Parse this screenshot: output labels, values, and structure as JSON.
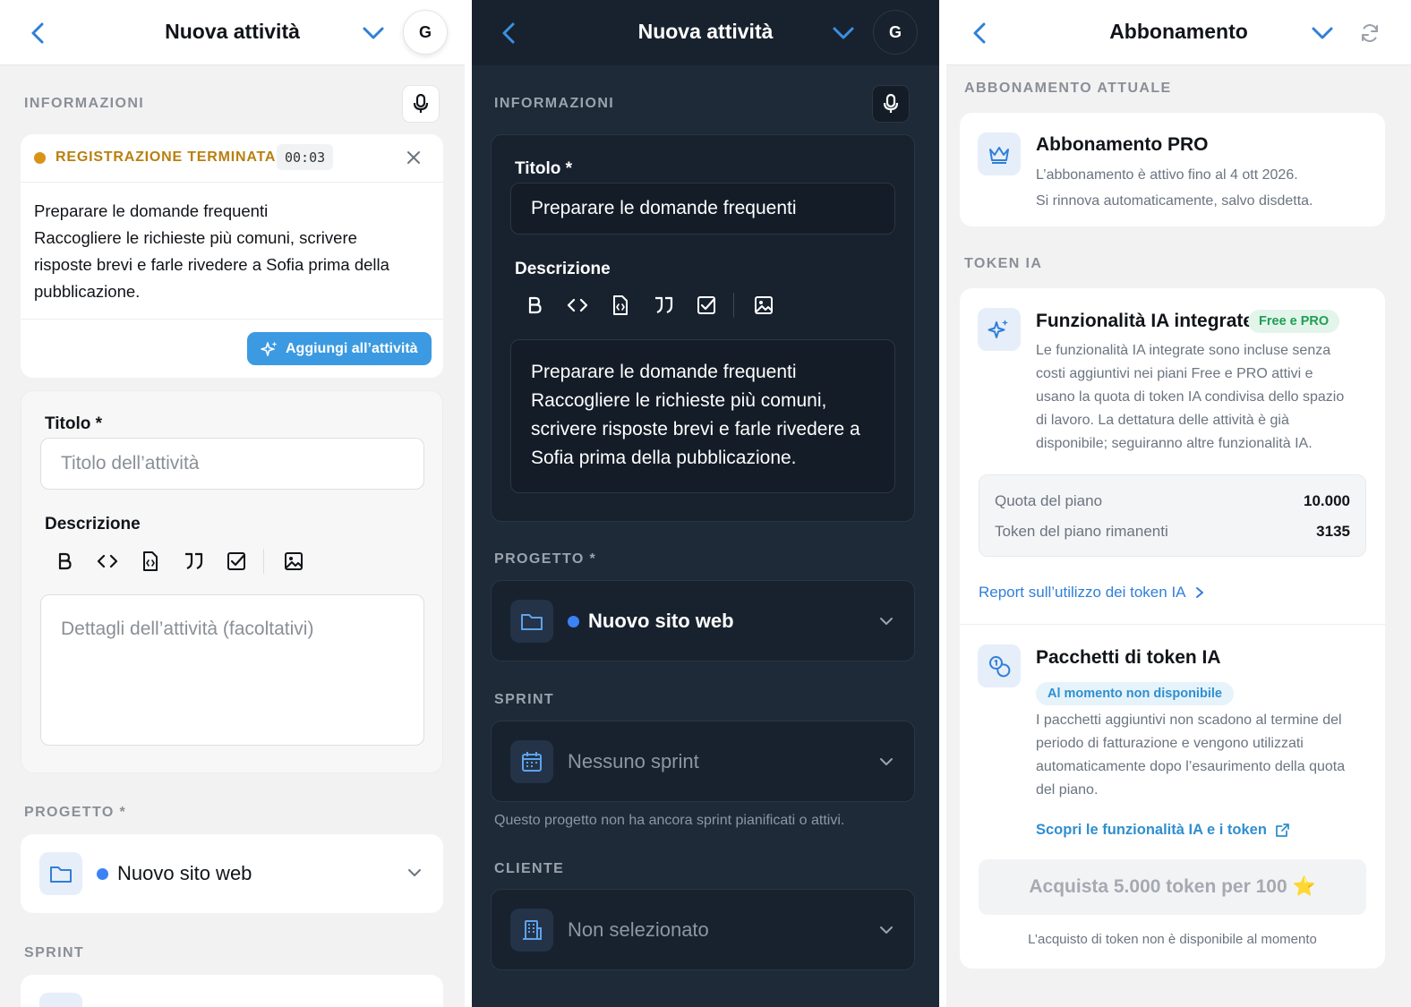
{
  "panel1": {
    "header": {
      "title": "Nuova attività",
      "avatar": "G"
    },
    "section_info": "INFORMAZIONI",
    "recording": {
      "status": "REGISTRAZIONE TERMINATA",
      "timer": "00:03",
      "transcript_lines": [
        "Preparare le domande frequenti",
        "Raccogliere le richieste più comuni, scrivere",
        "risposte brevi e farle rivedere a Sofia prima della",
        "pubblicazione."
      ],
      "add_button": "Aggiungi all’attività"
    },
    "form": {
      "title_label": "Titolo *",
      "title_placeholder": "Titolo dell’attività",
      "description_label": "Descrizione",
      "description_placeholder": "Dettagli dell’attività (facoltativi)"
    },
    "section_project": "PROGETTO *",
    "project_value": "Nuovo sito web",
    "section_sprint": "SPRINT"
  },
  "panel2": {
    "header": {
      "title": "Nuova attività",
      "avatar": "G"
    },
    "section_info": "INFORMAZIONI",
    "title_label": "Titolo *",
    "title_value": "Preparare le domande frequenti",
    "description_label": "Descrizione",
    "description_lines": [
      "Preparare le domande frequenti",
      "Raccogliere le richieste più comuni,",
      "scrivere risposte brevi e farle rivedere a",
      "Sofia prima della pubblicazione."
    ],
    "section_project": "PROGETTO *",
    "project_value": "Nuovo sito web",
    "section_sprint": "SPRINT",
    "sprint_value": "Nessuno sprint",
    "sprint_note": "Questo progetto non ha ancora sprint pianificati o attivi.",
    "section_client": "CLIENTE",
    "client_value": "Non selezionato"
  },
  "panel3": {
    "header": {
      "title": "Abbonamento"
    },
    "section_current": "ABBONAMENTO ATTUALE",
    "plan": {
      "name": "Abbonamento PRO",
      "line1": "L’abbonamento è attivo fino al 4 ott 2026.",
      "line2": "Si rinnova automaticamente, salvo disdetta."
    },
    "section_tokens": "TOKEN IA",
    "ai_features": {
      "title": "Funzionalità IA integrate",
      "badge": "Free e PRO",
      "desc_lines": [
        "Le funzionalità IA integrate sono incluse senza",
        "costi aggiuntivi nei piani Free e PRO attivi e",
        "usano la quota di token IA condivisa dello spazio",
        "di lavoro. La dettatura delle attività è già",
        "disponibile; seguiranno altre funzionalità IA."
      ],
      "quota_label": "Quota del piano",
      "quota_value": "10.000",
      "remaining_label": "Token del piano rimanenti",
      "remaining_value": "3135",
      "report_link": "Report sull’utilizzo dei token IA"
    },
    "packs": {
      "title": "Pacchetti di token IA",
      "badge": "Al momento non disponibile",
      "desc_lines": [
        "I pacchetti aggiuntivi non scadono al termine del",
        "periodo di fatturazione e vengono utilizzati",
        "automaticamente dopo l’esaurimento della quota",
        "del piano."
      ],
      "discover_link": "Scopri le funzionalità IA e i token",
      "buy_button": "Acquista 5.000 token per 100 ⭐",
      "buy_note": "L’acquisto di token non è disponibile al momento"
    }
  },
  "colors": {
    "accent_blue": "#2f7fd8",
    "record_orange": "#c9870f",
    "badge_green": "#1f9d55",
    "dark_bg": "#1f2a38"
  }
}
